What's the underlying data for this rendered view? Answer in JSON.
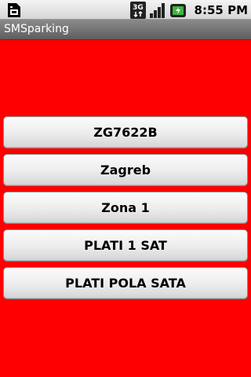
{
  "status_bar": {
    "time": "8:55 PM",
    "network_label": "3G",
    "icons": [
      "sim-notification-icon",
      "3g-data-icon",
      "signal-strength-icon",
      "battery-charging-icon"
    ]
  },
  "app": {
    "title": "SMSparking"
  },
  "buttons": [
    {
      "label": "ZG7622B"
    },
    {
      "label": "Zagreb"
    },
    {
      "label": "Zona 1"
    },
    {
      "label": "PLATI 1 SAT"
    },
    {
      "label": "PLATI POLA SATA"
    }
  ],
  "colors": {
    "background": "#ff0000",
    "title_bar": "#6e6e6e",
    "button": "#ececec"
  }
}
